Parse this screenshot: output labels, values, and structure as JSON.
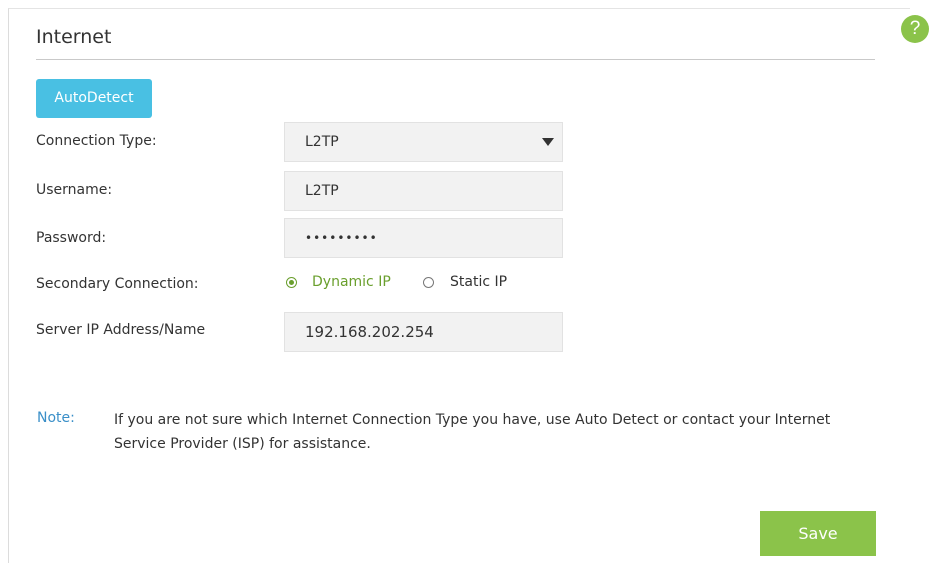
{
  "header": {
    "title": "Internet",
    "help_icon": "?"
  },
  "autodetect_label": "AutoDetect",
  "form": {
    "connection_type_label": "Connection Type:",
    "connection_type_value": "L2TP",
    "username_label": "Username:",
    "username_value": "L2TP",
    "password_label": "Password:",
    "password_value": "•••••••••",
    "secondary_label": "Secondary Connection:",
    "secondary_options": [
      {
        "label": "Dynamic IP",
        "selected": true
      },
      {
        "label": "Static IP",
        "selected": false
      }
    ],
    "server_label": "Server IP Address/Name",
    "server_value": "192.168.202.254"
  },
  "note": {
    "key": "Note:",
    "text": "If you are not sure which Internet Connection Type you have, use Auto Detect or contact your Internet Service Provider (ISP) for assistance."
  },
  "save_label": "Save",
  "colors": {
    "accent_blue": "#49c0e3",
    "accent_green": "#8bc34a",
    "note_blue": "#3a8fc8",
    "selected_green": "#6a9f2d"
  }
}
